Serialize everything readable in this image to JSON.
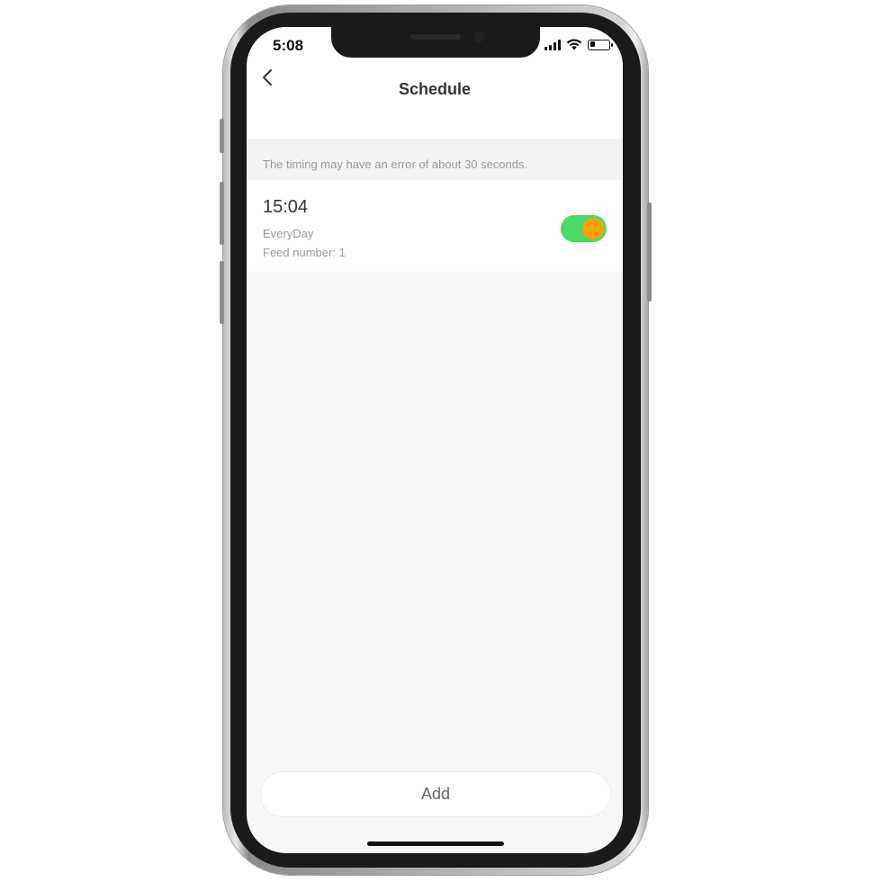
{
  "status_bar": {
    "time": "5:08",
    "icons": [
      "signal-icon",
      "wifi-icon",
      "battery-icon"
    ]
  },
  "header": {
    "title": "Schedule",
    "back_icon": "chevron-left-icon"
  },
  "notice": {
    "text": "The timing may have an error of about 30 seconds."
  },
  "schedules": [
    {
      "time": "15:04",
      "repeat": "EveryDay",
      "feed": "Feed number: 1",
      "enabled": true
    }
  ],
  "actions": {
    "add_label": "Add"
  },
  "colors": {
    "toggle_track": "#4cd964",
    "toggle_knob": "#ff9f0a",
    "background": "#f7f7f7"
  }
}
